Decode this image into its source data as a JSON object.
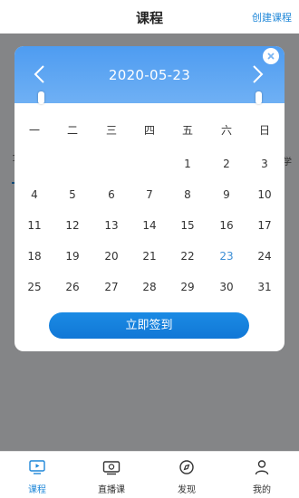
{
  "header": {
    "title": "课程",
    "action_label": "创建课程"
  },
  "background_page": {
    "left_text": "1",
    "right_text": "学"
  },
  "calendar": {
    "selected_date": "2020-05-23",
    "weekdays": [
      "一",
      "二",
      "三",
      "四",
      "五",
      "六",
      "日"
    ],
    "weeks": [
      [
        "",
        "",
        "",
        "",
        "1",
        "2",
        "3"
      ],
      [
        "4",
        "5",
        "6",
        "7",
        "8",
        "9",
        "10"
      ],
      [
        "11",
        "12",
        "13",
        "14",
        "15",
        "16",
        "17"
      ],
      [
        "18",
        "19",
        "20",
        "21",
        "22",
        "23",
        "24"
      ],
      [
        "25",
        "26",
        "27",
        "28",
        "29",
        "30",
        "31"
      ]
    ],
    "highlighted_day": "23",
    "signin_label": "立即签到",
    "colors": {
      "header_gradient_top": "#4e9cf1",
      "button": "#1b8be4",
      "today": "#3d8fd6"
    }
  },
  "tabs": [
    {
      "label": "课程",
      "icon": "monitor-play-icon",
      "active": true
    },
    {
      "label": "直播课",
      "icon": "tv-live-icon",
      "active": false
    },
    {
      "label": "发现",
      "icon": "compass-icon",
      "active": false
    },
    {
      "label": "我的",
      "icon": "user-icon",
      "active": false
    }
  ],
  "accent_color": "#1f87d8"
}
